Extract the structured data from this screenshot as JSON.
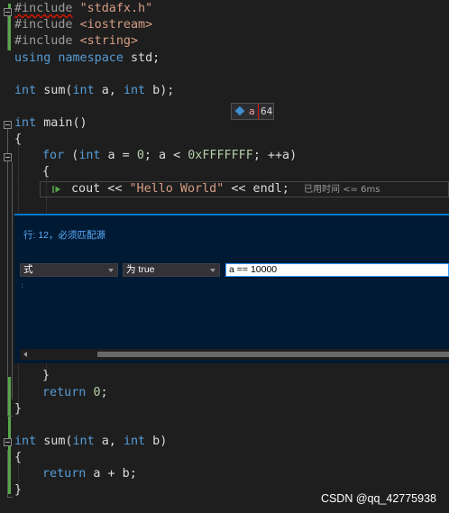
{
  "code": {
    "l1": {
      "pp": "#include",
      "str": "\"stdafx.h\""
    },
    "l2": {
      "pp": "#include",
      "str": "<iostream>"
    },
    "l3": {
      "pp": "#include",
      "str": "<string>"
    },
    "l4": {
      "kw1": "using",
      "kw2": "namespace",
      "rest": " std;"
    },
    "l5": {
      "kw1": "int",
      "name": " sum(",
      "kw2": "int",
      "mid": " a, ",
      "kw3": "int",
      "end": " b);"
    },
    "l6": {
      "kw": "int",
      "rest": " main()"
    },
    "l7": {
      "text": "{"
    },
    "l8": {
      "kw1": "for",
      "a": " (",
      "kw2": "int",
      "b": " a = ",
      "n1": "0",
      "c": "; a < ",
      "n2": "0xFFFFFFF",
      "d": "; ++a)"
    },
    "l9": {
      "text": "{"
    },
    "l10": {
      "a": "cout << ",
      "str": "\"Hello World\"",
      "b": " << endl;",
      "perf": "已用时间 <= 6ms"
    },
    "l11": {
      "text": "}"
    },
    "l12": {
      "kw": "return",
      "sp": " ",
      "n": "0",
      "rest": ";"
    },
    "l13": {
      "text": "}"
    },
    "l14": {
      "kw1": "int",
      "name": " sum(",
      "kw2": "int",
      "mid": " a, ",
      "kw3": "int",
      "end": " b)"
    },
    "l15": {
      "text": "{"
    },
    "l16": {
      "kw": "return",
      "rest": " a + b;"
    },
    "l17": {
      "text": "}"
    }
  },
  "datatip": {
    "var": "a",
    "value": "64"
  },
  "breakpoint_settings": {
    "title": "行: 12，必须匹配源",
    "condition_type": "式",
    "condition_mode": "为 true",
    "condition_value": "a == 10000"
  },
  "watermark": "CSDN @qq_42775938",
  "colors": {
    "background": "#1e1e1e",
    "keyword": "#569cd6",
    "string": "#d69d85",
    "number": "#b5cea8",
    "panel": "#001a33",
    "accent": "#007acc"
  }
}
